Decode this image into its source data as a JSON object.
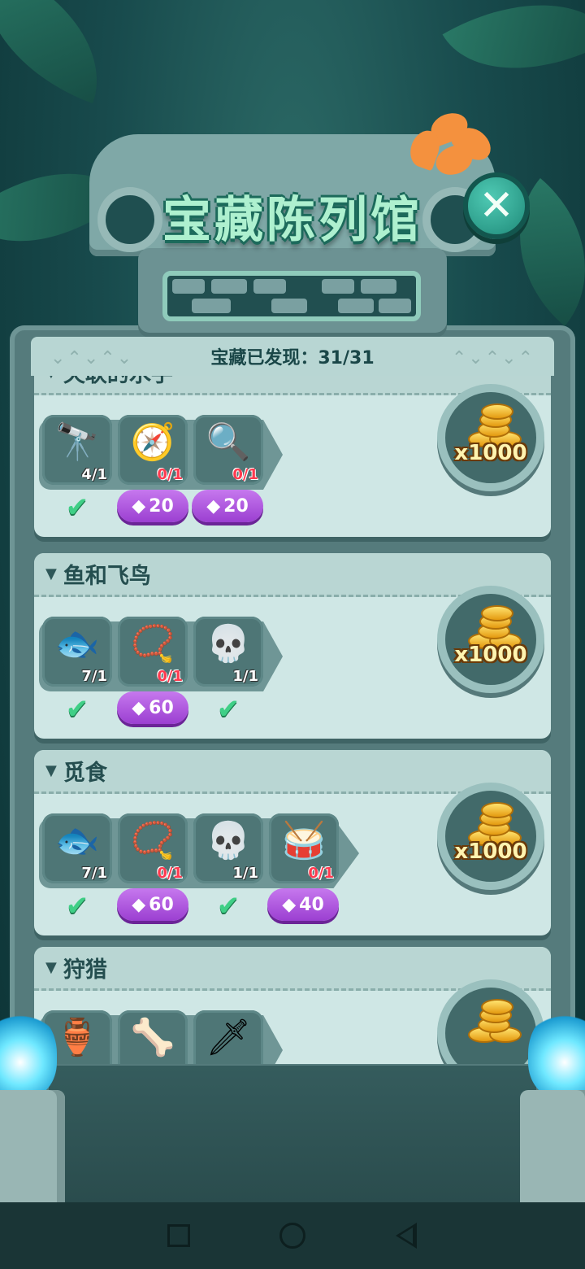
{
  "screen": {
    "title": "宝藏陈列馆",
    "close_icon": "close-icon",
    "progress_label": "宝藏已发现：31/31"
  },
  "collections": [
    {
      "name": "失联的水手",
      "items": [
        {
          "icon": "spyglass-icon",
          "glyph": "🔭",
          "qty": "4/1",
          "complete": true
        },
        {
          "icon": "compass-icon",
          "glyph": "🧭",
          "qty": "0/1",
          "complete": false,
          "price": "20"
        },
        {
          "icon": "magnifier-icon",
          "glyph": "🔍",
          "qty": "0/1",
          "complete": false,
          "price": "20"
        }
      ],
      "reward": "x1000"
    },
    {
      "name": "鱼和飞鸟",
      "items": [
        {
          "icon": "fish-fossil-icon",
          "glyph": "🐟",
          "qty": "7/1",
          "complete": true
        },
        {
          "icon": "tooth-necklace-icon",
          "glyph": "📿",
          "qty": "0/1",
          "complete": false,
          "price": "60"
        },
        {
          "icon": "bird-skull-icon",
          "glyph": "💀",
          "qty": "1/1",
          "complete": true
        }
      ],
      "reward": "x1000"
    },
    {
      "name": "觅食",
      "items": [
        {
          "icon": "fish-fossil-icon",
          "glyph": "🐟",
          "qty": "7/1",
          "complete": true
        },
        {
          "icon": "tooth-necklace-icon",
          "glyph": "📿",
          "qty": "0/1",
          "complete": false,
          "price": "60"
        },
        {
          "icon": "bird-skull-icon",
          "glyph": "💀",
          "qty": "1/1",
          "complete": true
        },
        {
          "icon": "drum-icon",
          "glyph": "🥁",
          "qty": "0/1",
          "complete": false,
          "price": "40"
        }
      ],
      "reward": "x1000"
    },
    {
      "name": "狩猎",
      "items": [
        {
          "icon": "clay-pot-icon",
          "glyph": "🏺",
          "qty": "",
          "complete": false
        },
        {
          "icon": "bone-tablet-icon",
          "glyph": "🦴",
          "qty": "",
          "complete": false
        },
        {
          "icon": "spear-icon",
          "glyph": "🗡",
          "qty": "",
          "complete": false
        }
      ],
      "reward": ""
    }
  ],
  "colors": {
    "accent_green": "#3fcf86",
    "gem_purple": "#9b3fd1",
    "missing_red": "#ff3a4f",
    "coin_gold": "#ffd24a"
  },
  "navbar": {
    "recent_icon": "square-icon",
    "home_icon": "circle-icon",
    "back_icon": "triangle-back-icon"
  }
}
